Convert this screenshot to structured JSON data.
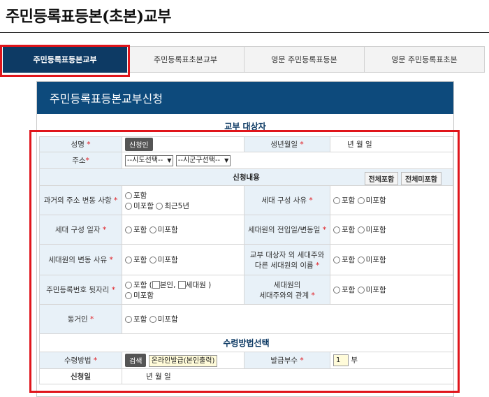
{
  "page_title": "주민등록표등본(초본)교부",
  "tabs": [
    {
      "label": "주민등록표등본교부",
      "active": true
    },
    {
      "label": "주민등록표초본교부",
      "active": false
    },
    {
      "label": "영문 주민등록표등본",
      "active": false
    },
    {
      "label": "영문 주민등록표초본",
      "active": false
    }
  ],
  "form": {
    "header": "주민등록표등본교부신청",
    "target_heading": "교부 대상자",
    "name_label": "성명",
    "required_mark": "*",
    "applicant_button": "신청인",
    "birth_label": "생년월일",
    "birth_value": "년   월   일",
    "address_label": "주소",
    "sido_select": "--시도선택--",
    "sigungu_select": "--시군구선택--",
    "content_heading": "신청내용",
    "include_all_button": "전체포함",
    "exclude_all_button": "전체미포함",
    "past_address_label": "과거의 주소 변동 사항",
    "past_address_opt1": "포함",
    "past_address_opt2": "미포함",
    "past_address_opt3": "최근5년",
    "household_reason_label": "세대 구성 사유",
    "household_date_label": "세대 구성 일자",
    "member_move_date_label": "세대원의 전입일/변동일",
    "member_change_reason_label": "세대원의 변동 사유",
    "other_member_names_label": "교부 대상자 외 세대주와 다른 세대원의 이름",
    "resident_no_label": "주민등록번호 뒷자리",
    "resident_no_opt1": "포함 (",
    "resident_no_self": "본인,",
    "resident_no_member": "세대원 )",
    "relation_label_line1": "세대원의",
    "relation_label_line2": "세대주와의 관계",
    "cohabitant_label": "동거인",
    "include_opt": "포함",
    "exclude_opt": "미포함",
    "receive_heading": "수령방법선택",
    "receive_method_label": "수령방법",
    "search_button": "검색",
    "receive_method_value": "온라인발급(본인출력)",
    "copies_label": "발급부수",
    "copies_value": "1",
    "copies_unit": "부",
    "apply_date_label": "신청일",
    "apply_date_value": "년   월   일"
  },
  "colors": {
    "accent": "#0d3a64",
    "header": "#0d4a7c",
    "highlight": "#e0151b",
    "label_bg": "#e8f1f8"
  }
}
